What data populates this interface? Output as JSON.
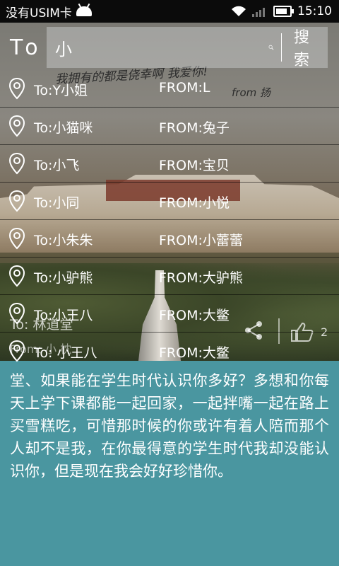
{
  "status_bar": {
    "carrier": "没有USIM卡",
    "time": "15:10",
    "icons": [
      "android-icon",
      "wifi-icon",
      "signal-icon",
      "battery-icon"
    ]
  },
  "app_bar": {
    "title": "To",
    "search": {
      "value": "小",
      "button_label": "搜索"
    }
  },
  "background": {
    "handwriting": "我拥有的都是侥幸啊 我爱你!",
    "handwriting_sign": "from 扬",
    "card_to": "To: 林道堂",
    "card_from": "From: 小 枕",
    "like_count": "2"
  },
  "results": [
    {
      "to": "To:Y小姐",
      "from": "FROM:L"
    },
    {
      "to": "To:小猫咪",
      "from": "FROM:兔子"
    },
    {
      "to": "To:小飞",
      "from": "FROM:宝贝"
    },
    {
      "to": "To:小同",
      "from": "FROM:小悦"
    },
    {
      "to": "To:小朱朱",
      "from": "FROM:小蕾蕾"
    },
    {
      "to": "To:小驴熊",
      "from": "FROM:大驴熊"
    },
    {
      "to": "To:小王八",
      "from": "FROM:大鳖"
    },
    {
      "to": "To: 小王八",
      "from": "FROM:大鳖"
    }
  ],
  "message": "堂、如果能在学生时代认识你多好？多想和你每天上学下课都能一起回家，一起拌嘴一起在路上买雪糕吃，可惜那时候的你或许有着人陪而那个人却不是我，在你最得意的学生时代我却没能认识你，但是现在我会好好珍惜你。",
  "colors": {
    "panel": "#4a96a0",
    "status_bar": "#0b0b0b"
  }
}
